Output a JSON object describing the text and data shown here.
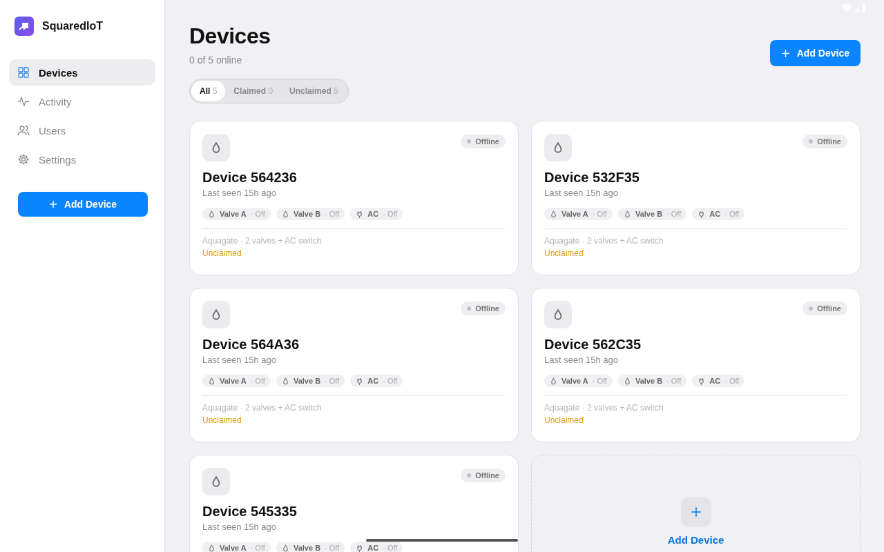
{
  "app": {
    "name": "SquaredIoT"
  },
  "sidebar": {
    "items": [
      {
        "label": "Devices",
        "selected": true
      },
      {
        "label": "Activity",
        "selected": false
      },
      {
        "label": "Users",
        "selected": false
      },
      {
        "label": "Settings",
        "selected": false
      }
    ],
    "button": "Add Device"
  },
  "header": {
    "title": "Devices",
    "subtitle": "0 of 5 online",
    "button": "Add Device"
  },
  "filters": [
    {
      "label": "All",
      "count": "5",
      "selected": true
    },
    {
      "label": "Claimed",
      "count": "0",
      "selected": false
    },
    {
      "label": "Unclaimed",
      "count": "5",
      "selected": false
    }
  ],
  "devices": [
    {
      "name": "Device 564236",
      "last_seen": "Last seen 15h ago",
      "status": "Offline",
      "online": false,
      "channels": [
        {
          "kind": "valve",
          "name": "Valve A",
          "state": "· Off"
        },
        {
          "kind": "valve",
          "name": "Valve B",
          "state": "· Off"
        },
        {
          "kind": "plug",
          "name": "AC",
          "state": "· Off"
        }
      ],
      "description": "Aquagate · 2 valves + AC switch",
      "claim": "Unclaimed",
      "claimed": false
    },
    {
      "name": "Device 532F35",
      "last_seen": "Last seen 15h ago",
      "status": "Offline",
      "online": false,
      "channels": [
        {
          "kind": "valve",
          "name": "Valve A",
          "state": "· Off"
        },
        {
          "kind": "valve",
          "name": "Valve B",
          "state": "· Off"
        },
        {
          "kind": "plug",
          "name": "AC",
          "state": "· Off"
        }
      ],
      "description": "Aquagate · 2 valves + AC switch",
      "claim": "Unclaimed",
      "claimed": false
    },
    {
      "name": "Device 564A36",
      "last_seen": "Last seen 15h ago",
      "status": "Offline",
      "online": false,
      "channels": [
        {
          "kind": "valve",
          "name": "Valve A",
          "state": "· Off"
        },
        {
          "kind": "valve",
          "name": "Valve B",
          "state": "· Off"
        },
        {
          "kind": "plug",
          "name": "AC",
          "state": "· Off"
        }
      ],
      "description": "Aquagate · 2 valves + AC switch",
      "claim": "Unclaimed",
      "claimed": false
    },
    {
      "name": "Device 562C35",
      "last_seen": "Last seen 15h ago",
      "status": "Offline",
      "online": false,
      "channels": [
        {
          "kind": "valve",
          "name": "Valve A",
          "state": "· Off"
        },
        {
          "kind": "valve",
          "name": "Valve B",
          "state": "· Off"
        },
        {
          "kind": "plug",
          "name": "AC",
          "state": "· Off"
        }
      ],
      "description": "Aquagate · 2 valves + AC switch",
      "claim": "Unclaimed",
      "claimed": false
    },
    {
      "name": "Device 545335",
      "last_seen": "Last seen 15h ago",
      "status": "Offline",
      "online": false,
      "channels": [
        {
          "kind": "valve",
          "name": "Valve A",
          "state": "· Off"
        },
        {
          "kind": "valve",
          "name": "Valve B",
          "state": "· Off"
        },
        {
          "kind": "plug",
          "name": "AC",
          "state": "· Off"
        }
      ]
    }
  ],
  "add_card": {
    "label": "Add Device"
  }
}
